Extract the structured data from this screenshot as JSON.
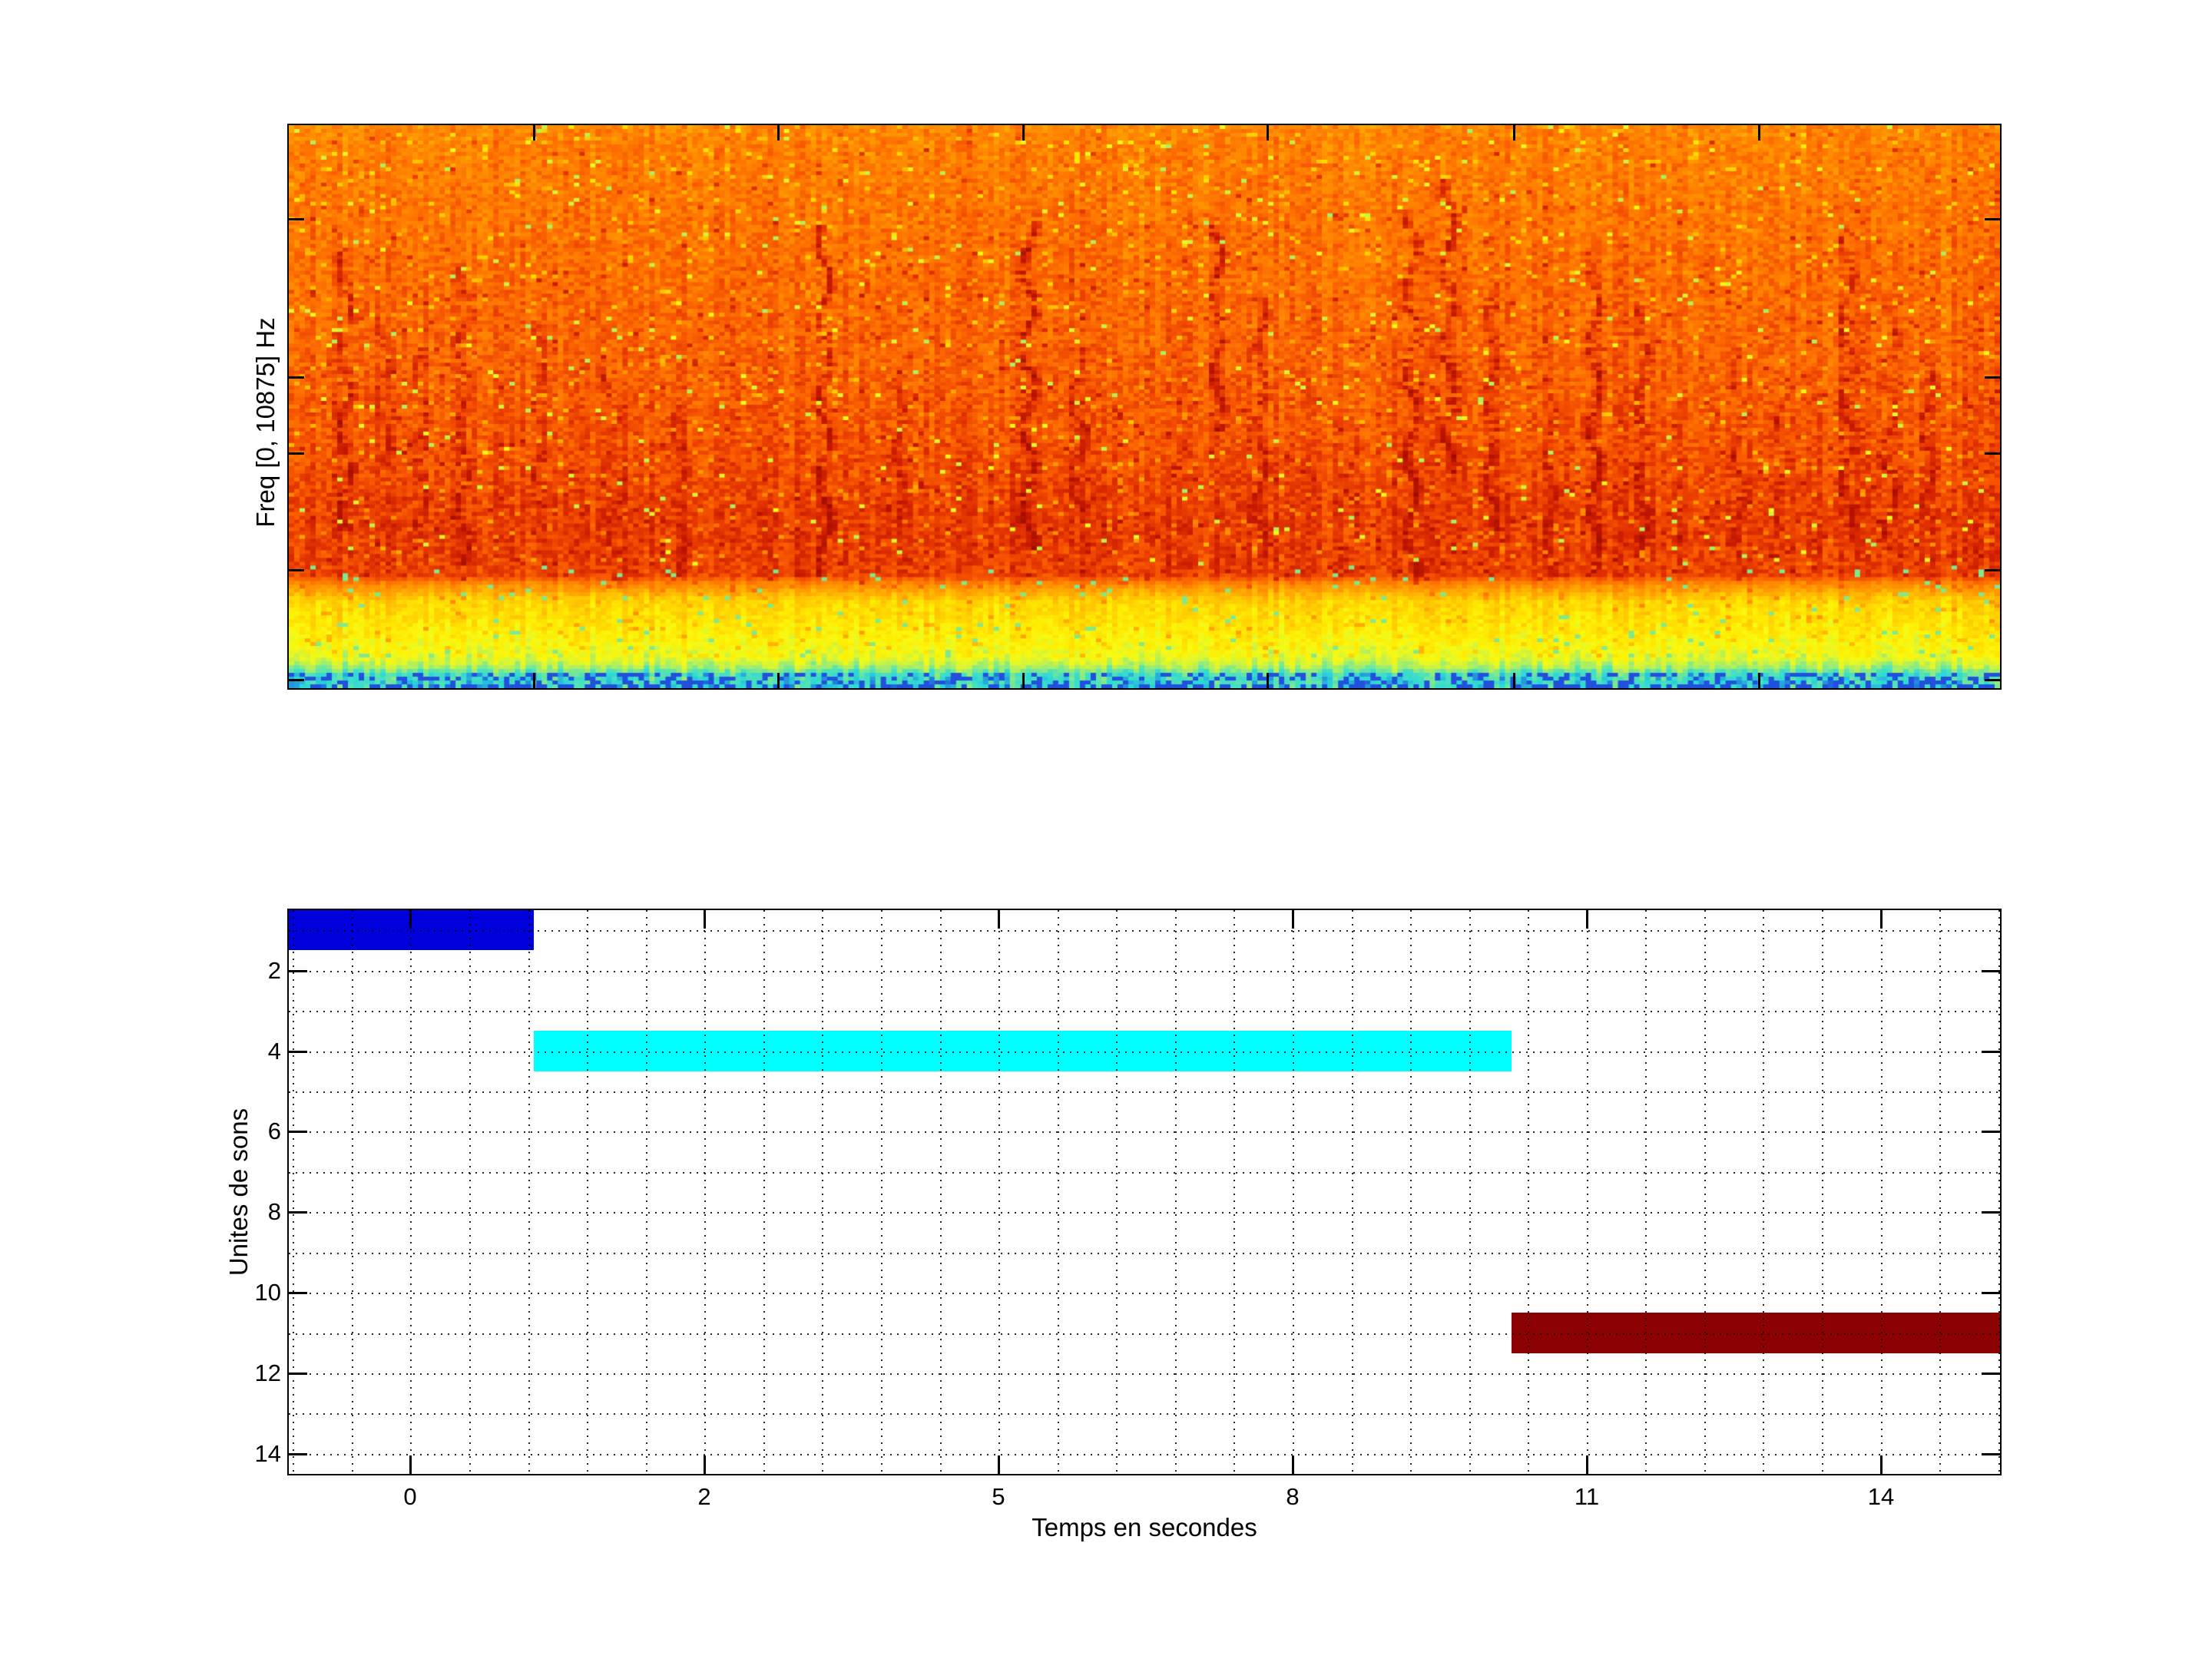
{
  "figure": {
    "background": "#FFFFFF",
    "axis_color": "#000000",
    "grid_color": "#000000"
  },
  "chart_data": [
    {
      "type": "heatmap",
      "subtype": "spectrogram",
      "title": "",
      "xlabel": "",
      "ylabel": "Freq [0, 10875] Hz",
      "freq_range_hz": [
        0,
        10875
      ],
      "colormap": "jet",
      "x_tick_labels": [],
      "y_tick_labels": [],
      "unlabeled_left_tick_fracs": [
        0.167,
        0.448,
        0.583,
        0.79,
        0.985
      ],
      "unlabeled_top_tick_fracs": [
        0.143,
        0.286,
        0.429,
        0.572,
        0.716,
        0.859
      ],
      "render": {
        "seed": 1337,
        "cols": 318,
        "rows": 147,
        "heat_profile": [
          [
            0,
            0.52
          ],
          [
            0.05,
            0.55
          ],
          [
            0.3,
            0.6
          ],
          [
            0.55,
            0.65
          ],
          [
            0.7,
            0.71
          ],
          [
            0.8,
            0.7
          ],
          [
            0.815,
            0.52
          ],
          [
            0.845,
            0.33
          ],
          [
            0.9,
            0.27
          ],
          [
            0.945,
            0.21
          ],
          [
            0.965,
            0.13
          ],
          [
            0.975,
            0.07
          ],
          [
            1,
            0.05
          ]
        ],
        "palette": [
          [
            1.0,
            "#9E0C00"
          ],
          [
            0.82,
            "#C41800"
          ],
          [
            0.74,
            "#E03000"
          ],
          [
            0.66,
            "#F55200"
          ],
          [
            0.58,
            "#FF7300"
          ],
          [
            0.5,
            "#FF8F00"
          ],
          [
            0.42,
            "#FFAD00"
          ],
          [
            0.34,
            "#FFCE00"
          ],
          [
            0.27,
            "#FFEC00"
          ],
          [
            0.22,
            "#F7FA12"
          ],
          [
            0.17,
            "#D2F43A"
          ],
          [
            0.12,
            "#90EC7E"
          ],
          [
            0.08,
            "#4CE2BC"
          ],
          [
            0.04,
            "#2CD8D8"
          ],
          [
            0.0,
            "#2066E0"
          ]
        ],
        "cyan_band_start_frac": 0.975,
        "cyan_dash_color": "#2050DC",
        "streaks": [
          [
            0.03,
            0.22,
            0.72,
            0.8
          ],
          [
            0.052,
            0.35,
            0.6,
            0.45
          ],
          [
            0.075,
            0.4,
            0.75,
            0.5
          ],
          [
            0.1,
            0.25,
            0.78,
            0.6
          ],
          [
            0.145,
            0.35,
            0.68,
            0.45
          ],
          [
            0.19,
            0.45,
            0.82,
            0.45
          ],
          [
            0.225,
            0.5,
            0.8,
            0.35
          ],
          [
            0.31,
            0.18,
            0.8,
            0.85
          ],
          [
            0.355,
            0.45,
            0.78,
            0.5
          ],
          [
            0.43,
            0.15,
            0.75,
            0.85
          ],
          [
            0.46,
            0.4,
            0.7,
            0.5
          ],
          [
            0.54,
            0.18,
            0.55,
            0.9
          ],
          [
            0.565,
            0.3,
            0.78,
            0.6
          ],
          [
            0.62,
            0.5,
            0.8,
            0.4
          ],
          [
            0.655,
            0.15,
            0.8,
            0.9
          ],
          [
            0.675,
            0.1,
            0.62,
            0.85
          ],
          [
            0.7,
            0.3,
            0.72,
            0.6
          ],
          [
            0.735,
            0.45,
            0.8,
            0.45
          ],
          [
            0.76,
            0.22,
            0.8,
            0.7
          ],
          [
            0.79,
            0.32,
            0.75,
            0.6
          ],
          [
            0.845,
            0.38,
            0.8,
            0.6
          ],
          [
            0.87,
            0.45,
            0.75,
            0.45
          ],
          [
            0.91,
            0.2,
            0.72,
            0.65
          ],
          [
            0.935,
            0.3,
            0.75,
            0.6
          ],
          [
            0.955,
            0.4,
            0.7,
            0.45
          ]
        ]
      }
    },
    {
      "type": "bar",
      "subtype": "gantt-horizontal",
      "title": "",
      "xlabel": "Temps en secondes",
      "ylabel": "Unites de sons",
      "u_min": -2.07,
      "u_max": 27.03,
      "v_min": 0.5,
      "v_max": 14.5,
      "x_major_ticks": [
        {
          "u": 0,
          "label": "0"
        },
        {
          "u": 5,
          "label": "2"
        },
        {
          "u": 10,
          "label": "5"
        },
        {
          "u": 15,
          "label": "8"
        },
        {
          "u": 20,
          "label": "11"
        },
        {
          "u": 25,
          "label": "14"
        }
      ],
      "y_major_ticks": [
        2,
        4,
        6,
        8,
        10,
        12,
        14
      ],
      "grid": "dotted",
      "bars": [
        {
          "name": "sound-unit-1",
          "row": 1,
          "u_start": -2.07,
          "u_end": 2.09,
          "start_s": -0.8,
          "end_s": 0.8,
          "color": "#0000DD"
        },
        {
          "name": "sound-unit-4",
          "row": 4,
          "u_start": 2.09,
          "u_end": 18.72,
          "start_s": 0.8,
          "end_s": 10.2,
          "color": "#00FFFF"
        },
        {
          "name": "sound-unit-11",
          "row": 11,
          "u_start": 18.72,
          "u_end": 27.03,
          "start_s": 10.2,
          "end_s": 15.2,
          "color": "#8B0000"
        }
      ]
    }
  ]
}
